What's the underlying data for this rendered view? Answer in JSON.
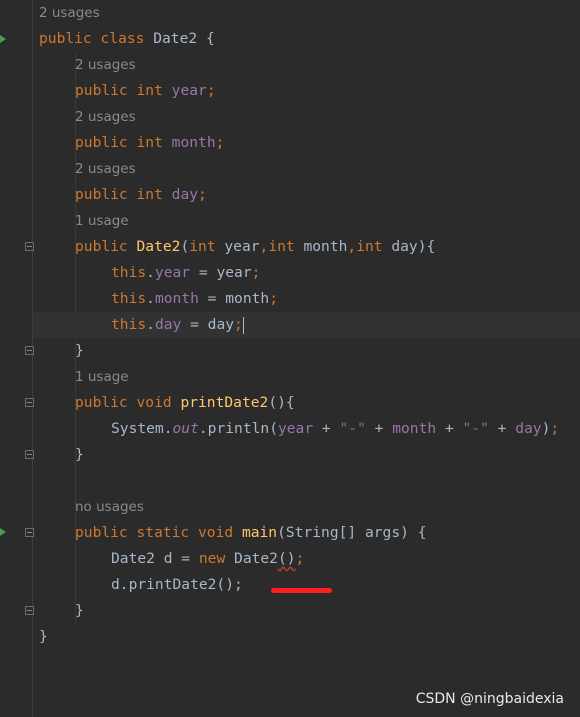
{
  "code": {
    "usage_2_a": "2 usages",
    "class_kw": "public class",
    "class_name": "Date2",
    "open_brace": " {",
    "usage_2_b": "2 usages",
    "field_year": "year",
    "usage_2_c": "2 usages",
    "field_month": "month",
    "usage_2_d": "2 usages",
    "field_day": "day",
    "usage_1_a": "1 usage",
    "ctor_name": "Date2",
    "ctor_params": "(",
    "usage_1_b": "1 usage",
    "method_print": "printDate2",
    "println_call": "println",
    "dash_str": "\"-\"",
    "no_usages": "no usages",
    "method_main": "main",
    "main_params": "(String[] args) {",
    "main_body_1": "Date2 d = ",
    "main_body_new": "new",
    "main_body_ctor": "Date2",
    "main_body_parens": "()",
    "main_body_2": "d.printDate2();"
  },
  "watermark": "CSDN @ningbaidexia",
  "colors": {
    "background": "#2b2b2b",
    "keyword": "#cc7832",
    "field": "#9876aa",
    "function": "#ffc66d",
    "string": "#6a8759",
    "plain": "#a9b7c6",
    "annotation_red": "#ff1d1d"
  }
}
